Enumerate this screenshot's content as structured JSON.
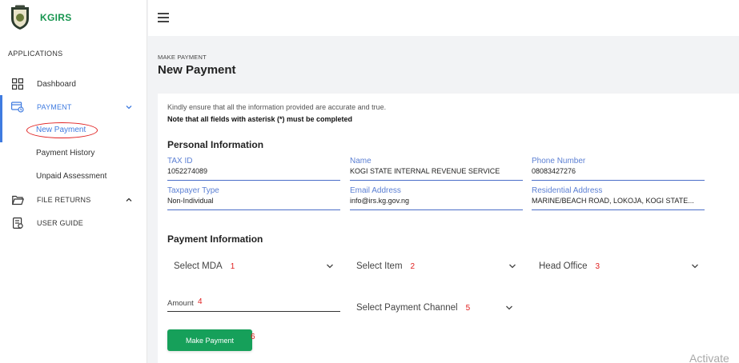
{
  "brand": {
    "name": "KGIRS"
  },
  "sidebar": {
    "section_title": "APPLICATIONS",
    "dashboard": "Dashboard",
    "payment": "PAYMENT",
    "sub_items": [
      "New Payment",
      "Payment History",
      "Unpaid Assessment"
    ],
    "file_returns": "FILE RETURNS",
    "user_guide": "USER GUIDE"
  },
  "header": {
    "breadcrumb": "MAKE PAYMENT",
    "title": "New Payment"
  },
  "notes": {
    "line1": "Kindly ensure that all the information provided are accurate and true.",
    "line2": "Note that all fields with asterisk (*) must be completed"
  },
  "personal": {
    "title": "Personal Information",
    "fields": [
      {
        "label": "TAX ID",
        "value": "1052274089"
      },
      {
        "label": "Name",
        "value": "KOGI STATE INTERNAL REVENUE SERVICE"
      },
      {
        "label": "Phone Number",
        "value": "08083427276"
      },
      {
        "label": "Taxpayer Type",
        "value": "Non-Individual"
      },
      {
        "label": "Email Address",
        "value": "info@irs.kg.gov.ng"
      },
      {
        "label": "Residential Address",
        "value": "MARINE/BEACH ROAD, LOKOJA, KOGI STATE..."
      }
    ]
  },
  "payment": {
    "title": "Payment Information",
    "mda": {
      "label": "Select MDA",
      "annotation": "1"
    },
    "item": {
      "label": "Select Item",
      "annotation": "2"
    },
    "office": {
      "label": "Head Office",
      "annotation": "3"
    },
    "amount": {
      "placeholder": "Amount",
      "annotation": "4"
    },
    "channel": {
      "label": "Select Payment Channel",
      "annotation": "5"
    },
    "submit": {
      "label": "Make Payment",
      "annotation": "6"
    }
  },
  "watermark": "Activate",
  "colors": {
    "brand_green": "#17954f",
    "accent_blue": "#3f7be0",
    "button_green": "#16a05a",
    "annotation_red": "#e02020"
  }
}
